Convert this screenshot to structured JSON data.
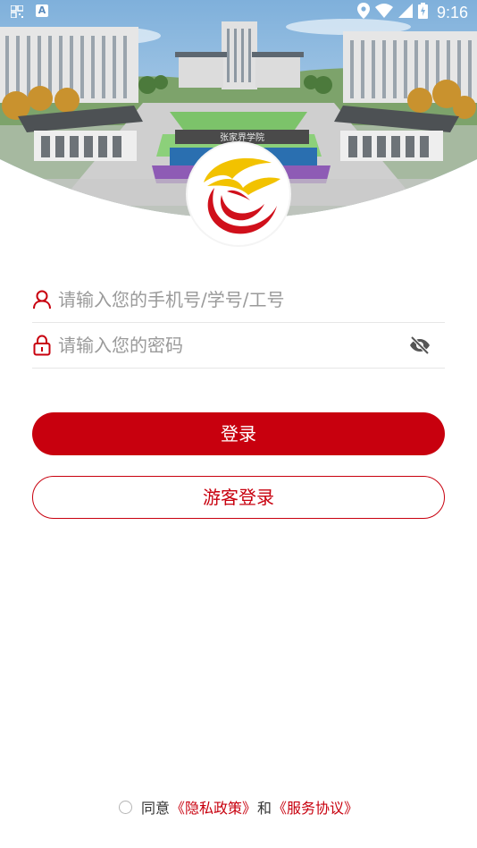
{
  "status_bar": {
    "time": "9:16",
    "left_icons": [
      "qr-icon",
      "a-badge-icon"
    ],
    "a_badge_letter": "A",
    "right_icons": [
      "location-icon",
      "wifi-icon",
      "signal-icon",
      "battery-icon"
    ],
    "battery_charging": true
  },
  "header": {
    "campus_sign": "张家界学院"
  },
  "login_form": {
    "phone_placeholder": "请输入您的手机号/学号/工号",
    "password_placeholder": "请输入您的密码",
    "phone_value": "",
    "password_value": ""
  },
  "buttons": {
    "login_label": "登录",
    "guest_login_label": "游客登录"
  },
  "agreement": {
    "checked": false,
    "prefix": "同意",
    "privacy_link": "《隐私政策》",
    "joiner": "和",
    "service_link": "《服务协议》"
  },
  "colors": {
    "primary": "#c8000e",
    "logo_yellow": "#f2c200",
    "logo_red": "#d0101b",
    "divider": "#e6e6e6",
    "placeholder": "#9a9a9a"
  }
}
